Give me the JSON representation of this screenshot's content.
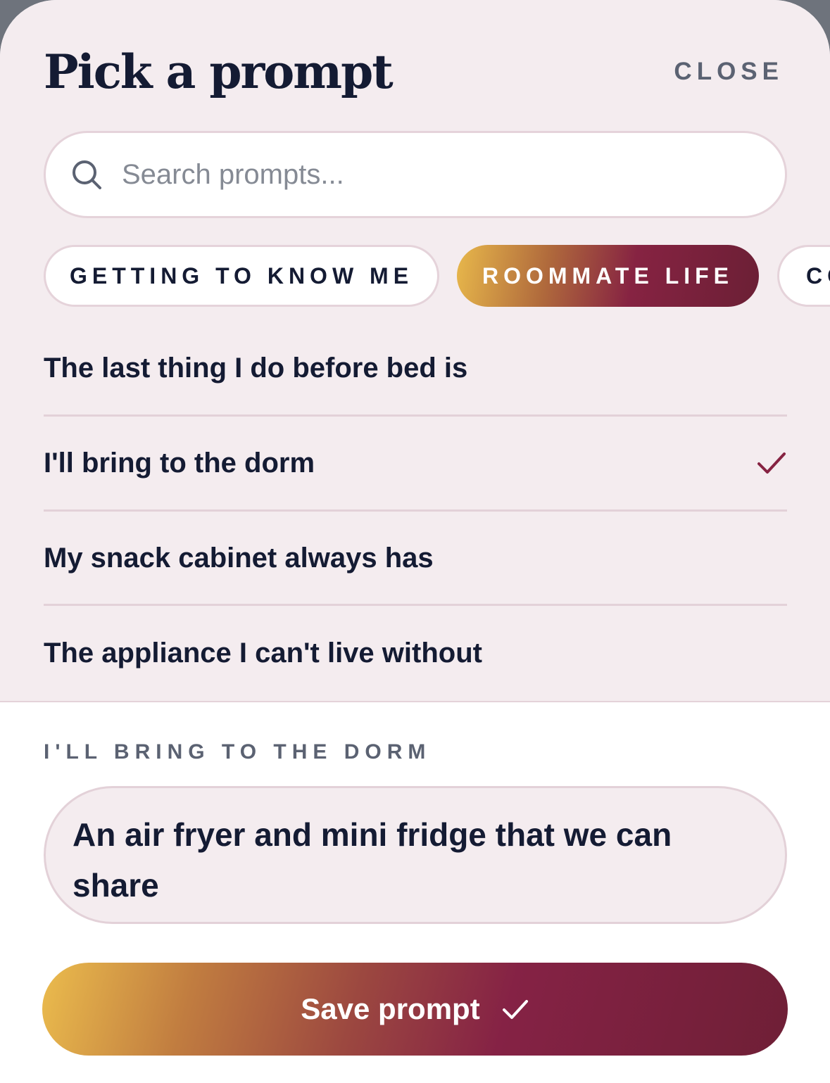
{
  "header": {
    "title": "Pick a prompt",
    "close_label": "CLOSE"
  },
  "search": {
    "placeholder": "Search prompts..."
  },
  "categories": [
    {
      "label": "GETTING TO KNOW ME",
      "active": false
    },
    {
      "label": "ROOMMATE LIFE",
      "active": true
    },
    {
      "label": "CO",
      "active": false
    }
  ],
  "prompts": [
    {
      "text": "The last thing I do before bed is",
      "selected": false
    },
    {
      "text": "I'll bring to the dorm",
      "selected": true
    },
    {
      "text": "My snack cabinet always has",
      "selected": false
    },
    {
      "text": "The appliance I can't live without",
      "selected": false
    }
  ],
  "answer": {
    "label": "I'LL BRING TO THE DORM",
    "text": "An air fryer and mini fridge that we can share"
  },
  "save_button": {
    "label": "Save prompt"
  },
  "colors": {
    "accent": "#862342",
    "gold": "#ebbc4d",
    "text": "#141b33"
  }
}
